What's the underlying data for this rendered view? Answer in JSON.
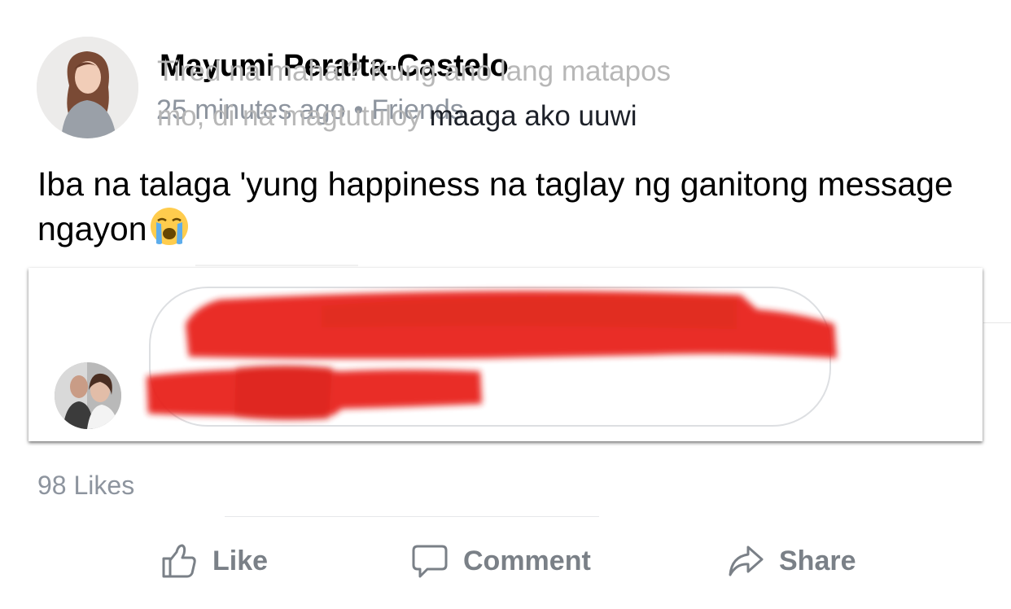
{
  "post": {
    "author_name": "Mayumi Peralta-Castelo",
    "time_ago": "25 minutes ago",
    "separator": "•",
    "audience": "Friends",
    "text": "Iba na talaga 'yung happiness na taglay ng ganitong message ngayon",
    "emoji": "crying-face-emoji"
  },
  "message": {
    "line1_hidden": "Tired na mahal? Kung ano lang matapos",
    "line2_hidden": "mo, di na magtutuloy",
    "line2_visible": " maaga ako uuwi",
    "redaction_color": "#e8231a"
  },
  "reactions": {
    "likes": "98 Likes"
  },
  "actions": {
    "like_label": "Like",
    "comment_label": "Comment",
    "share_label": "Share"
  },
  "colors": {
    "meta_gray": "#8d949e",
    "action_gray": "#7a8087",
    "bubble_border": "#dddfe2"
  }
}
